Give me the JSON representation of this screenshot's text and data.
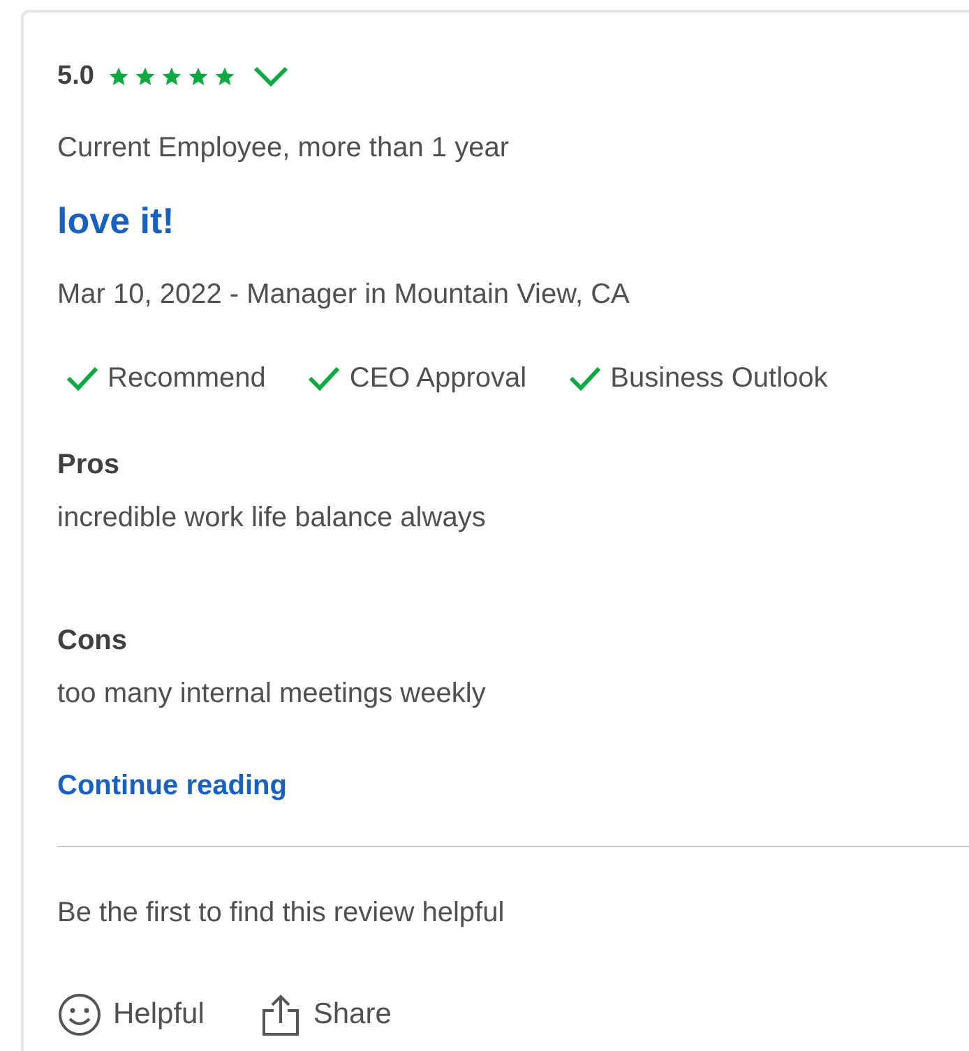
{
  "review": {
    "rating": "5.0",
    "stars": 5,
    "employee_status": "Current Employee, more than 1 year",
    "title": "love it!",
    "date_role": "Mar 10, 2022 - Manager in Mountain View, CA",
    "ratings": [
      {
        "label": "Recommend",
        "kind": "positive"
      },
      {
        "label": "CEO Approval",
        "kind": "positive"
      },
      {
        "label": "Business Outlook",
        "kind": "positive"
      }
    ],
    "sections": [
      {
        "heading": "Pros",
        "text": "incredible work life balance always"
      },
      {
        "heading": "Cons",
        "text": "too many internal meetings weekly"
      }
    ],
    "continue_link": "Continue reading",
    "helpful_prompt": "Be the first to find this review helpful",
    "actions": [
      {
        "kind": "helpful",
        "label": "Helpful"
      },
      {
        "kind": "share",
        "label": "Share"
      }
    ]
  }
}
